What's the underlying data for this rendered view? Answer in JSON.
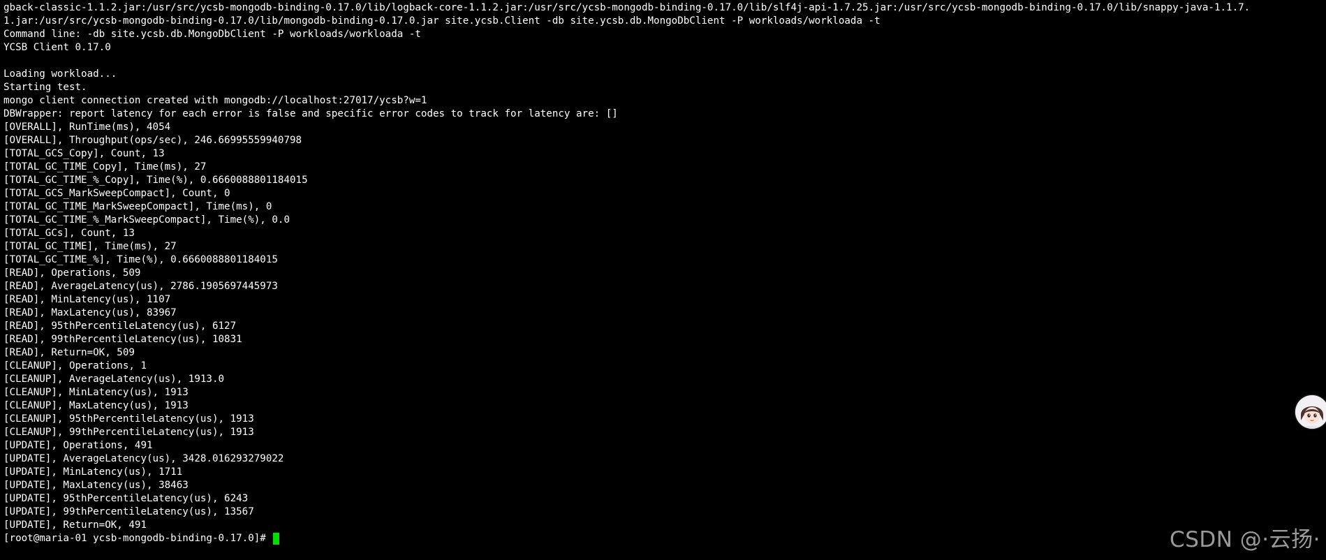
{
  "terminal": {
    "lines": [
      "gback-classic-1.1.2.jar:/usr/src/ycsb-mongodb-binding-0.17.0/lib/logback-core-1.1.2.jar:/usr/src/ycsb-mongodb-binding-0.17.0/lib/slf4j-api-1.7.25.jar:/usr/src/ycsb-mongodb-binding-0.17.0/lib/snappy-java-1.1.7.",
      "1.jar:/usr/src/ycsb-mongodb-binding-0.17.0/lib/mongodb-binding-0.17.0.jar site.ycsb.Client -db site.ycsb.db.MongoDbClient -P workloads/workloada -t",
      "Command line: -db site.ycsb.db.MongoDbClient -P workloads/workloada -t",
      "YCSB Client 0.17.0",
      "",
      "Loading workload...",
      "Starting test.",
      "mongo client connection created with mongodb://localhost:27017/ycsb?w=1",
      "DBWrapper: report latency for each error is false and specific error codes to track for latency are: []",
      "[OVERALL], RunTime(ms), 4054",
      "[OVERALL], Throughput(ops/sec), 246.66995559940798",
      "[TOTAL_GCS_Copy], Count, 13",
      "[TOTAL_GC_TIME_Copy], Time(ms), 27",
      "[TOTAL_GC_TIME_%_Copy], Time(%), 0.6660088801184015",
      "[TOTAL_GCS_MarkSweepCompact], Count, 0",
      "[TOTAL_GC_TIME_MarkSweepCompact], Time(ms), 0",
      "[TOTAL_GC_TIME_%_MarkSweepCompact], Time(%), 0.0",
      "[TOTAL_GCs], Count, 13",
      "[TOTAL_GC_TIME], Time(ms), 27",
      "[TOTAL_GC_TIME_%], Time(%), 0.6660088801184015",
      "[READ], Operations, 509",
      "[READ], AverageLatency(us), 2786.1905697445973",
      "[READ], MinLatency(us), 1107",
      "[READ], MaxLatency(us), 83967",
      "[READ], 95thPercentileLatency(us), 6127",
      "[READ], 99thPercentileLatency(us), 10831",
      "[READ], Return=OK, 509",
      "[CLEANUP], Operations, 1",
      "[CLEANUP], AverageLatency(us), 1913.0",
      "[CLEANUP], MinLatency(us), 1913",
      "[CLEANUP], MaxLatency(us), 1913",
      "[CLEANUP], 95thPercentileLatency(us), 1913",
      "[CLEANUP], 99thPercentileLatency(us), 1913",
      "[UPDATE], Operations, 491",
      "[UPDATE], AverageLatency(us), 3428.016293279022",
      "[UPDATE], MinLatency(us), 1711",
      "[UPDATE], MaxLatency(us), 38463",
      "[UPDATE], 95thPercentileLatency(us), 6243",
      "[UPDATE], 99thPercentileLatency(us), 13567",
      "[UPDATE], Return=OK, 491"
    ],
    "prompt": "[root@maria-01 ycsb-mongodb-binding-0.17.0]# ",
    "colors": {
      "background": "#000000",
      "text": "#ffffff",
      "cursor": "#00e000"
    }
  },
  "overlay": {
    "avatar_icon": "assistant-avatar-icon",
    "watermark": "CSDN @·云扬·"
  }
}
